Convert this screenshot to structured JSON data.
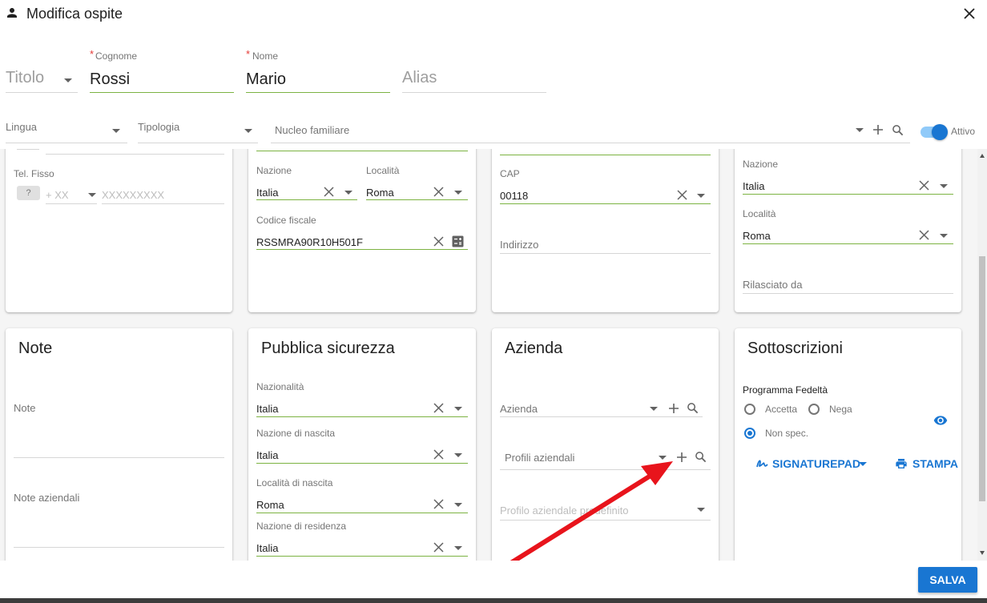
{
  "dialog": {
    "title": "Modifica ospite"
  },
  "header_fields": {
    "titolo": {
      "placeholder": "Titolo"
    },
    "cognome": {
      "label": "Cognome",
      "value": "Rossi"
    },
    "nome": {
      "label": "Nome",
      "value": "Mario"
    },
    "alias": {
      "placeholder": "Alias"
    },
    "lingua": {
      "label": "Lingua"
    },
    "tipologia": {
      "label": "Tipologia"
    },
    "nucleo": {
      "label": "Nucleo familiare"
    },
    "attivo": {
      "label": "Attivo",
      "on": true
    }
  },
  "upper_cards": {
    "card1": {
      "tel_fisso_label": "Tel. Fisso",
      "tel_badge": "?",
      "prefix_placeholder": "+ XX",
      "number_placeholder": "XXXXXXXXX"
    },
    "card2": {
      "nazione_label": "Nazione",
      "nazione_value": "Italia",
      "localita_label": "Località",
      "localita_value": "Roma",
      "cf_label": "Codice fiscale",
      "cf_value": "RSSMRA90R10H501F"
    },
    "card3": {
      "cap_label": "CAP",
      "cap_value": "00118",
      "indirizzo_placeholder": "Indirizzo"
    },
    "card4": {
      "nazione_label": "Nazione",
      "nazione_value": "Italia",
      "localita_label": "Località",
      "localita_value": "Roma",
      "rilasciato_placeholder": "Rilasciato da"
    }
  },
  "note_card": {
    "title": "Note",
    "note_label": "Note",
    "note_aziendali_label": "Note aziendali"
  },
  "ps_card": {
    "title": "Pubblica sicurezza",
    "fields": [
      {
        "label": "Nazionalità",
        "value": "Italia"
      },
      {
        "label": "Nazione di nascita",
        "value": "Italia"
      },
      {
        "label": "Località di nascita",
        "value": "Roma"
      },
      {
        "label": "Nazione di residenza",
        "value": "Italia"
      }
    ]
  },
  "azienda_card": {
    "title": "Azienda",
    "azienda_label": "Azienda",
    "profili_label": "Profili aziendali",
    "profilo_predefinito_label": "Profilo aziendale predefinito"
  },
  "sottoscrizioni_card": {
    "title": "Sottoscrizioni",
    "programma_label": "Programma Fedeltà",
    "options": [
      "Accetta",
      "Nega",
      "Non spec."
    ],
    "selected": "Non spec.",
    "signaturepad_label": "SIGNATUREPAD",
    "stampa_label": "STAMPA"
  },
  "footer": {
    "save_label": "SALVA"
  },
  "colors": {
    "primary": "#1976d2",
    "valid_underline": "#7cb342",
    "required": "#e53935",
    "annotation_arrow": "#e8141c"
  },
  "icons": [
    "person-icon",
    "close-icon",
    "dropdown-arrow-icon",
    "clear-icon",
    "add-icon",
    "search-icon",
    "calculator-icon",
    "eye-icon",
    "signature-icon",
    "print-icon"
  ]
}
